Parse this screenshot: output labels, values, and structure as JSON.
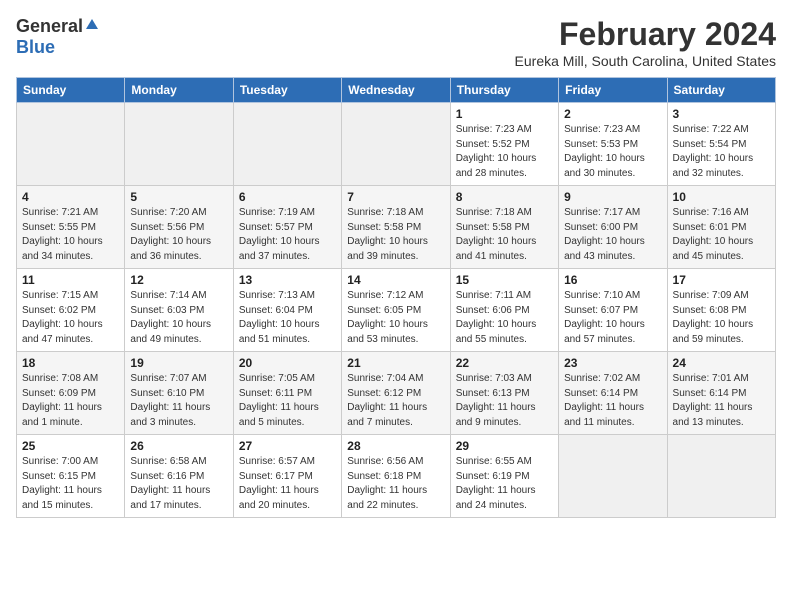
{
  "header": {
    "logo_general": "General",
    "logo_blue": "Blue",
    "month_year": "February 2024",
    "location": "Eureka Mill, South Carolina, United States"
  },
  "days_of_week": [
    "Sunday",
    "Monday",
    "Tuesday",
    "Wednesday",
    "Thursday",
    "Friday",
    "Saturday"
  ],
  "weeks": [
    [
      {
        "day": "",
        "info": ""
      },
      {
        "day": "",
        "info": ""
      },
      {
        "day": "",
        "info": ""
      },
      {
        "day": "",
        "info": ""
      },
      {
        "day": "1",
        "info": "Sunrise: 7:23 AM\nSunset: 5:52 PM\nDaylight: 10 hours\nand 28 minutes."
      },
      {
        "day": "2",
        "info": "Sunrise: 7:23 AM\nSunset: 5:53 PM\nDaylight: 10 hours\nand 30 minutes."
      },
      {
        "day": "3",
        "info": "Sunrise: 7:22 AM\nSunset: 5:54 PM\nDaylight: 10 hours\nand 32 minutes."
      }
    ],
    [
      {
        "day": "4",
        "info": "Sunrise: 7:21 AM\nSunset: 5:55 PM\nDaylight: 10 hours\nand 34 minutes."
      },
      {
        "day": "5",
        "info": "Sunrise: 7:20 AM\nSunset: 5:56 PM\nDaylight: 10 hours\nand 36 minutes."
      },
      {
        "day": "6",
        "info": "Sunrise: 7:19 AM\nSunset: 5:57 PM\nDaylight: 10 hours\nand 37 minutes."
      },
      {
        "day": "7",
        "info": "Sunrise: 7:18 AM\nSunset: 5:58 PM\nDaylight: 10 hours\nand 39 minutes."
      },
      {
        "day": "8",
        "info": "Sunrise: 7:18 AM\nSunset: 5:58 PM\nDaylight: 10 hours\nand 41 minutes."
      },
      {
        "day": "9",
        "info": "Sunrise: 7:17 AM\nSunset: 6:00 PM\nDaylight: 10 hours\nand 43 minutes."
      },
      {
        "day": "10",
        "info": "Sunrise: 7:16 AM\nSunset: 6:01 PM\nDaylight: 10 hours\nand 45 minutes."
      }
    ],
    [
      {
        "day": "11",
        "info": "Sunrise: 7:15 AM\nSunset: 6:02 PM\nDaylight: 10 hours\nand 47 minutes."
      },
      {
        "day": "12",
        "info": "Sunrise: 7:14 AM\nSunset: 6:03 PM\nDaylight: 10 hours\nand 49 minutes."
      },
      {
        "day": "13",
        "info": "Sunrise: 7:13 AM\nSunset: 6:04 PM\nDaylight: 10 hours\nand 51 minutes."
      },
      {
        "day": "14",
        "info": "Sunrise: 7:12 AM\nSunset: 6:05 PM\nDaylight: 10 hours\nand 53 minutes."
      },
      {
        "day": "15",
        "info": "Sunrise: 7:11 AM\nSunset: 6:06 PM\nDaylight: 10 hours\nand 55 minutes."
      },
      {
        "day": "16",
        "info": "Sunrise: 7:10 AM\nSunset: 6:07 PM\nDaylight: 10 hours\nand 57 minutes."
      },
      {
        "day": "17",
        "info": "Sunrise: 7:09 AM\nSunset: 6:08 PM\nDaylight: 10 hours\nand 59 minutes."
      }
    ],
    [
      {
        "day": "18",
        "info": "Sunrise: 7:08 AM\nSunset: 6:09 PM\nDaylight: 11 hours\nand 1 minute."
      },
      {
        "day": "19",
        "info": "Sunrise: 7:07 AM\nSunset: 6:10 PM\nDaylight: 11 hours\nand 3 minutes."
      },
      {
        "day": "20",
        "info": "Sunrise: 7:05 AM\nSunset: 6:11 PM\nDaylight: 11 hours\nand 5 minutes."
      },
      {
        "day": "21",
        "info": "Sunrise: 7:04 AM\nSunset: 6:12 PM\nDaylight: 11 hours\nand 7 minutes."
      },
      {
        "day": "22",
        "info": "Sunrise: 7:03 AM\nSunset: 6:13 PM\nDaylight: 11 hours\nand 9 minutes."
      },
      {
        "day": "23",
        "info": "Sunrise: 7:02 AM\nSunset: 6:14 PM\nDaylight: 11 hours\nand 11 minutes."
      },
      {
        "day": "24",
        "info": "Sunrise: 7:01 AM\nSunset: 6:14 PM\nDaylight: 11 hours\nand 13 minutes."
      }
    ],
    [
      {
        "day": "25",
        "info": "Sunrise: 7:00 AM\nSunset: 6:15 PM\nDaylight: 11 hours\nand 15 minutes."
      },
      {
        "day": "26",
        "info": "Sunrise: 6:58 AM\nSunset: 6:16 PM\nDaylight: 11 hours\nand 17 minutes."
      },
      {
        "day": "27",
        "info": "Sunrise: 6:57 AM\nSunset: 6:17 PM\nDaylight: 11 hours\nand 20 minutes."
      },
      {
        "day": "28",
        "info": "Sunrise: 6:56 AM\nSunset: 6:18 PM\nDaylight: 11 hours\nand 22 minutes."
      },
      {
        "day": "29",
        "info": "Sunrise: 6:55 AM\nSunset: 6:19 PM\nDaylight: 11 hours\nand 24 minutes."
      },
      {
        "day": "",
        "info": ""
      },
      {
        "day": "",
        "info": ""
      }
    ]
  ]
}
